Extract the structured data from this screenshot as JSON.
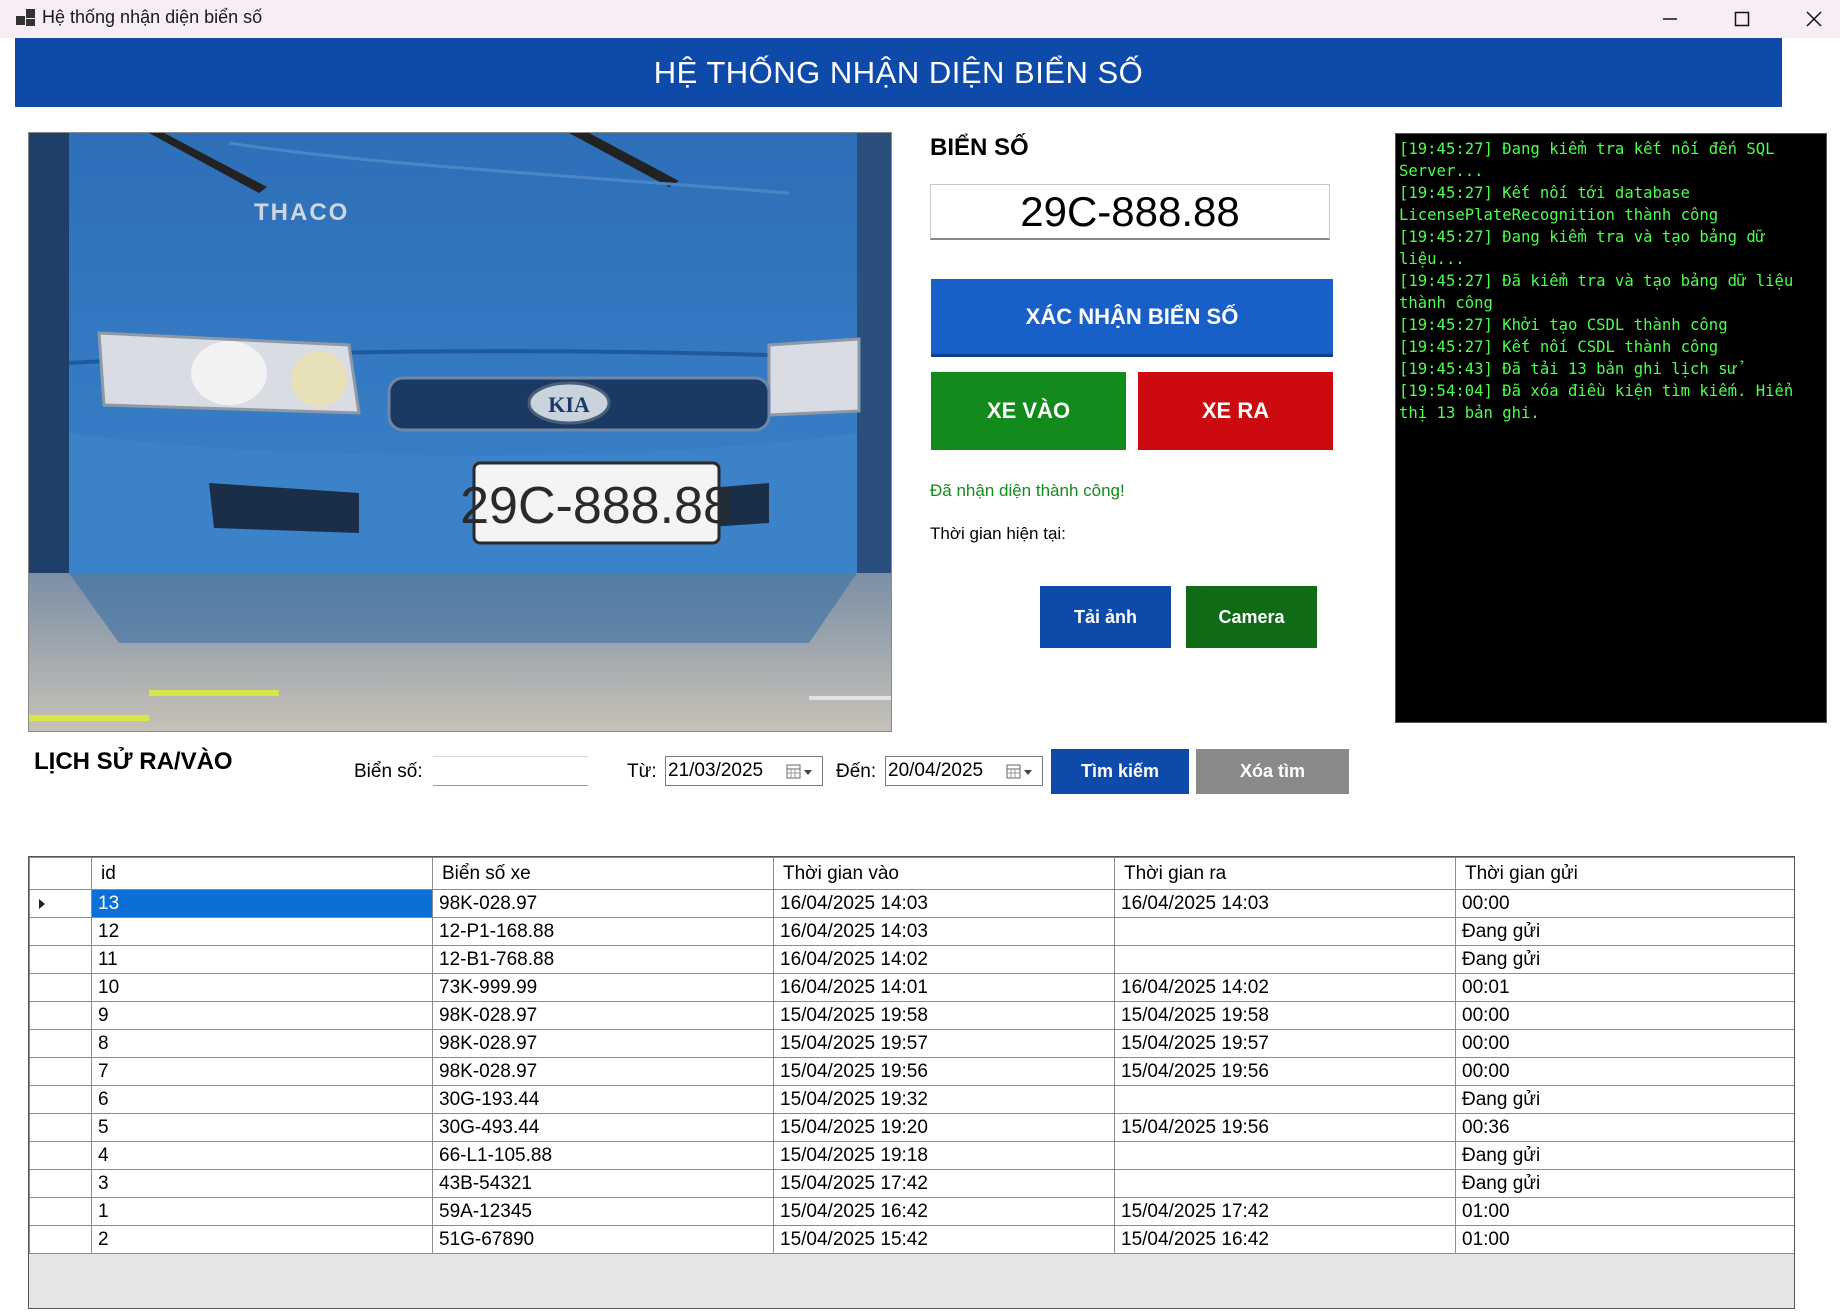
{
  "window": {
    "title": "Hệ thống nhận diện biển số"
  },
  "header": {
    "title": "HỆ THỐNG NHẬN DIỆN BIỂN SỐ"
  },
  "plate": {
    "heading": "BIỂN SỐ",
    "value": "29C-888.88"
  },
  "camera_image": {
    "brand_text": "THACO",
    "logo_text": "KIA",
    "plate_text": "29C-888.88"
  },
  "actions": {
    "confirm_label": "XÁC NHẬN BIỂN SỐ",
    "in_label": "XE VÀO",
    "out_label": "XE RA",
    "load_image_label": "Tải ảnh",
    "camera_label": "Camera"
  },
  "status": {
    "message": "Đã nhận diện thành công!",
    "current_time_label": "Thời gian hiện tại:"
  },
  "log": [
    "[19:45:27] Đang kiểm tra kết nối đến SQL Server...",
    "[19:45:27] Kết nối tới database LicensePlateRecognition thành công",
    "[19:45:27] Đang kiểm tra và tạo bảng dữ liệu...",
    "[19:45:27] Đã kiểm tra và tạo bảng dữ liệu thành công",
    "[19:45:27] Khởi tạo CSDL thành công",
    "[19:45:27] Kết nối CSDL thành công",
    "[19:45:43] Đã tải 13 bản ghi lịch sử",
    "[19:54:04] Đã xóa điều kiện tìm kiếm. Hiển thị 13 bản ghi."
  ],
  "history": {
    "title": "LỊCH SỬ RA/VÀO",
    "plate_label": "Biển số:",
    "plate_value": "",
    "from_label": "Từ:",
    "from_value": "21/03/2025",
    "to_label": "Đến:",
    "to_value": "20/04/2025",
    "search_label": "Tìm kiếm",
    "clear_label": "Xóa tìm"
  },
  "table": {
    "columns": [
      "id",
      "Biển số xe",
      "Thời gian vào",
      "Thời gian ra",
      "Thời gian gửi"
    ],
    "rows": [
      [
        "13",
        "98K-028.97",
        "16/04/2025 14:03",
        "16/04/2025 14:03",
        "00:00"
      ],
      [
        "12",
        "12-P1-168.88",
        "16/04/2025 14:03",
        "",
        "Đang gửi"
      ],
      [
        "11",
        "12-B1-768.88",
        "16/04/2025 14:02",
        "",
        "Đang gửi"
      ],
      [
        "10",
        "73K-999.99",
        "16/04/2025 14:01",
        "16/04/2025 14:02",
        "00:01"
      ],
      [
        "9",
        "98K-028.97",
        "15/04/2025 19:58",
        "15/04/2025 19:58",
        "00:00"
      ],
      [
        "8",
        "98K-028.97",
        "15/04/2025 19:57",
        "15/04/2025 19:57",
        "00:00"
      ],
      [
        "7",
        "98K-028.97",
        "15/04/2025 19:56",
        "15/04/2025 19:56",
        "00:00"
      ],
      [
        "6",
        "30G-193.44",
        "15/04/2025 19:32",
        "",
        "Đang gửi"
      ],
      [
        "5",
        "30G-493.44",
        "15/04/2025 19:20",
        "15/04/2025 19:56",
        "00:36"
      ],
      [
        "4",
        "66-L1-105.88",
        "15/04/2025 19:18",
        "",
        "Đang gửi"
      ],
      [
        "3",
        "43B-54321",
        "15/04/2025 17:42",
        "",
        "Đang gửi"
      ],
      [
        "1",
        "59A-12345",
        "15/04/2025 16:42",
        "15/04/2025 17:42",
        "01:00"
      ],
      [
        "2",
        "51G-67890",
        "15/04/2025 15:42",
        "15/04/2025 16:42",
        "01:00"
      ]
    ],
    "selected_row": 0
  },
  "colors": {
    "primary_blue": "#0d4aaa",
    "confirm_blue": "#1860c8",
    "green": "#138a1c",
    "red": "#cc0a10",
    "gray": "#8a8a8a",
    "log_text": "#4cff4c"
  }
}
